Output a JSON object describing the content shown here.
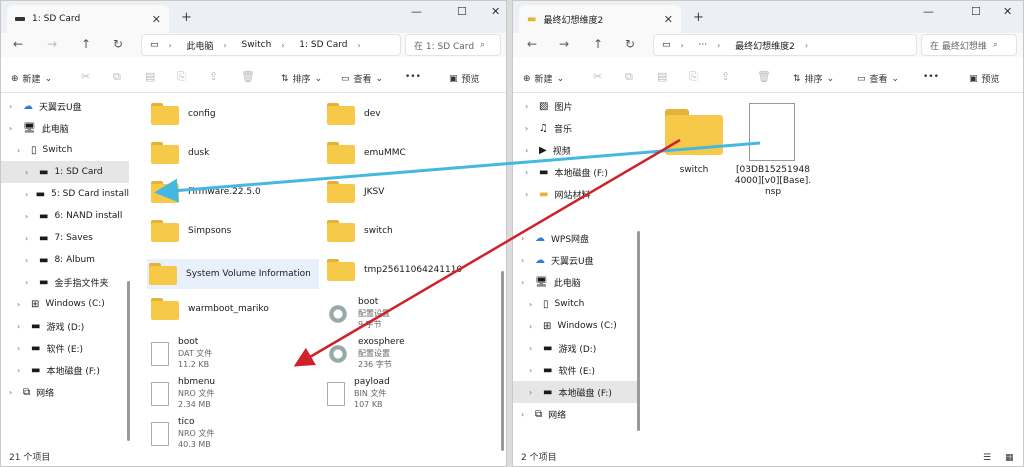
{
  "left": {
    "tab_title": "1: SD Card",
    "breadcrumb": [
      "此电脑",
      "Switch",
      "1: SD Card"
    ],
    "search_placeholder": "在 1: SD Card",
    "toolbar": {
      "new": "新建",
      "sort": "排序",
      "view": "查看",
      "more": "•••",
      "preview": "预览"
    },
    "nav": [
      {
        "label": "天翼云U盘",
        "icon": "cloud-icon"
      },
      {
        "label": "此电脑",
        "icon": "computer-icon"
      },
      {
        "label": "Switch",
        "icon": "device-icon"
      },
      {
        "label": "1: SD Card",
        "icon": "drive-icon",
        "selected": true
      },
      {
        "label": "5: SD Card install",
        "icon": "drive-icon"
      },
      {
        "label": "6: NAND install",
        "icon": "drive-icon"
      },
      {
        "label": "7: Saves",
        "icon": "drive-icon"
      },
      {
        "label": "8: Album",
        "icon": "drive-icon"
      },
      {
        "label": "金手指文件夹",
        "icon": "drive-icon"
      },
      {
        "label": "Windows (C:)",
        "icon": "windows-drive-icon"
      },
      {
        "label": "游戏 (D:)",
        "icon": "drive-icon"
      },
      {
        "label": "软件 (E:)",
        "icon": "drive-icon"
      },
      {
        "label": "本地磁盘 (F:)",
        "icon": "drive-icon"
      },
      {
        "label": "网络",
        "icon": "network-icon"
      }
    ],
    "items_col1": [
      {
        "name": "config",
        "type": "folder"
      },
      {
        "name": "dusk",
        "type": "folder"
      },
      {
        "name": "Firmware.22.5.0",
        "type": "folder"
      },
      {
        "name": "Simpsons",
        "type": "folder"
      },
      {
        "name": "System Volume Information",
        "type": "folder"
      },
      {
        "name": "warmboot_mariko",
        "type": "folder"
      },
      {
        "name": "boot",
        "type": "file",
        "kind": "DAT 文件",
        "size": "11.2 KB"
      },
      {
        "name": "hbmenu",
        "type": "file",
        "kind": "NRO 文件",
        "size": "2.34 MB"
      },
      {
        "name": "tico",
        "type": "file",
        "kind": "NRO 文件",
        "size": "40.3 MB"
      }
    ],
    "items_col2": [
      {
        "name": "dev",
        "type": "folder"
      },
      {
        "name": "emuMMC",
        "type": "folder"
      },
      {
        "name": "JKSV",
        "type": "folder"
      },
      {
        "name": "switch",
        "type": "folder"
      },
      {
        "name": "tmp25611064241110",
        "type": "folder"
      },
      {
        "name": "boot",
        "type": "config",
        "kind": "配置设置",
        "size": "9 字节"
      },
      {
        "name": "exosphere",
        "type": "config",
        "kind": "配置设置",
        "size": "236 字节"
      },
      {
        "name": "payload",
        "type": "file",
        "kind": "BIN 文件",
        "size": "107 KB"
      }
    ],
    "status": "21 个项目"
  },
  "right": {
    "tab_title": "最终幻想维度2",
    "breadcrumb_more": "···",
    "breadcrumb": [
      "最终幻想维度2"
    ],
    "search_placeholder": "在 最终幻想维",
    "toolbar": {
      "new": "新建",
      "sort": "排序",
      "view": "查看",
      "more": "•••",
      "preview": "预览"
    },
    "nav": [
      {
        "label": "图片",
        "icon": "picture-icon"
      },
      {
        "label": "音乐",
        "icon": "music-icon"
      },
      {
        "label": "视频",
        "icon": "video-icon"
      },
      {
        "label": "本地磁盘 (F:)",
        "icon": "drive-icon"
      },
      {
        "label": "网站材料",
        "icon": "folder-icon"
      },
      {
        "label": "WPS网盘",
        "icon": "cloud-icon"
      },
      {
        "label": "天翼云U盘",
        "icon": "cloud-icon"
      },
      {
        "label": "此电脑",
        "icon": "computer-icon"
      },
      {
        "label": "Switch",
        "icon": "device-icon"
      },
      {
        "label": "Windows (C:)",
        "icon": "windows-drive-icon"
      },
      {
        "label": "游戏 (D:)",
        "icon": "drive-icon"
      },
      {
        "label": "软件 (E:)",
        "icon": "drive-icon"
      },
      {
        "label": "本地磁盘 (F:)",
        "icon": "drive-icon",
        "selected": true
      },
      {
        "label": "网络",
        "icon": "network-icon"
      }
    ],
    "items": [
      {
        "name": "switch",
        "type": "folder"
      },
      {
        "name_lines": [
          "[03DB15251948",
          "4000][v0][Base].",
          "nsp"
        ],
        "type": "file"
      }
    ],
    "status": "2 个项目"
  },
  "colors": {
    "arrow_blue": "#45b8e0",
    "arrow_red": "#d0202a",
    "folder": "#f7c948",
    "selection": "#e6e6e6"
  }
}
